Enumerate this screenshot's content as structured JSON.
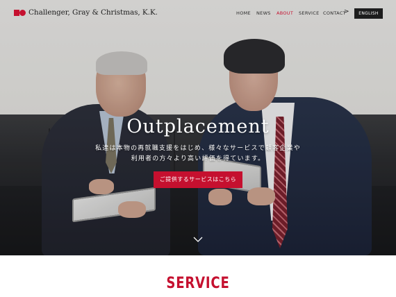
{
  "header": {
    "company_name": "Challenger, Gray & Christmas, K.K.",
    "nav": [
      {
        "label": "HOME",
        "active": false
      },
      {
        "label": "NEWS",
        "active": false
      },
      {
        "label": "ABOUT",
        "active": true
      },
      {
        "label": "SERVICE",
        "active": false
      },
      {
        "label": "CONTACT",
        "active": false
      }
    ],
    "next_icon": "chevron-right-icon",
    "language_button": "ENGLISH"
  },
  "hero": {
    "title": "Outplacement",
    "description_line1": "私達は本物の再就職支援をはじめ、様々なサービスで顧客企業や",
    "description_line2": "利用者の方々より高い評価を得ています。",
    "cta_label": "ご提供するサービスはこちら",
    "scroll_icon": "chevron-down-icon"
  },
  "section": {
    "title": "SERVICE"
  },
  "colors": {
    "brand_red": "#c5102f",
    "button_dark": "#1d1d1d"
  }
}
